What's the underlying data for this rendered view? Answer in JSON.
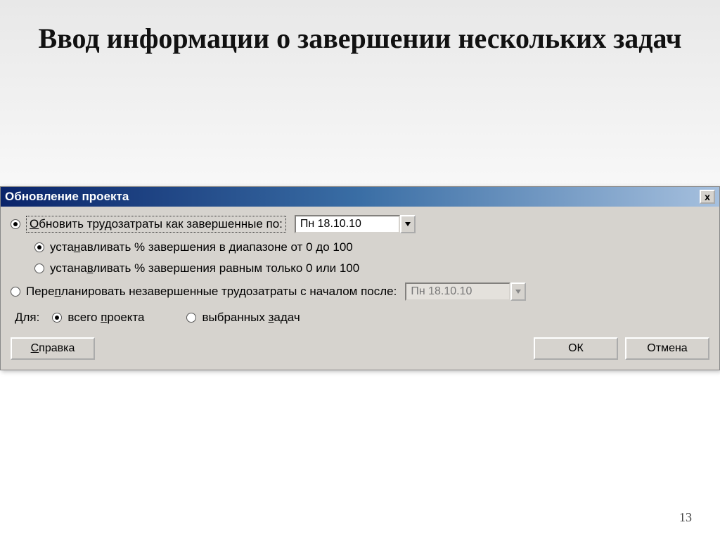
{
  "slide": {
    "title": "Ввод информации о завершении нескольких задач",
    "page_number": "13"
  },
  "dialog": {
    "title": "Обновление проекта",
    "close_label": "x",
    "opt_update": "Обновить трудозатраты как завершенные по:",
    "date1": "Пн 18.10.10",
    "sub_opt_range": "устанавливать % завершения в диапазоне от 0 до 100",
    "sub_opt_zero_hundred": "устанавливать % завершения равным только 0 или 100",
    "opt_reschedule": "Перепланировать незавершенные трудозатраты с началом после:",
    "date2": "Пн 18.10.10",
    "scope_label": "Для:",
    "scope_all_pre": "всего ",
    "scope_all_u": "п",
    "scope_all_post": "роекта",
    "scope_selected_pre": "выбранных ",
    "scope_selected_u": "з",
    "scope_selected_post": "адач",
    "help_pre": "С",
    "help_post": "правка",
    "ok": "ОК",
    "cancel": "Отмена",
    "underline_chars": {
      "update_O": "О",
      "update_rest": "бновить трудозатраты как завершенные по:",
      "range_n": "н",
      "range_pre": "уста",
      "range_post": "авливать % завершения в диапазоне от 0 до 100",
      "zero_pre": "устана",
      "zero_u": "в",
      "zero_post": "ливать % завершения равным только 0 или 100",
      "resched_pre": "Пере",
      "resched_u": "п",
      "resched_post": "ланировать незавершенные трудозатраты с началом после:"
    }
  }
}
